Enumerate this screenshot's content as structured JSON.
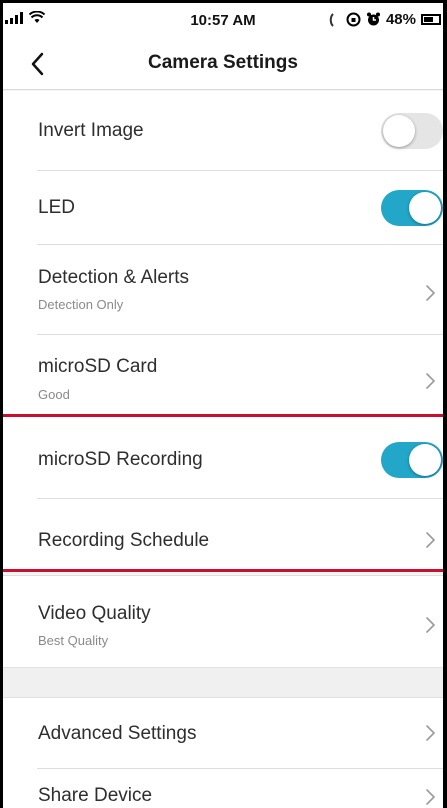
{
  "status_bar": {
    "time": "10:57 AM",
    "battery_text": "48%",
    "icons": [
      "signal-icon",
      "wifi-icon",
      "call-icon",
      "lock-rotation-icon",
      "alarm-icon",
      "battery-icon"
    ]
  },
  "nav": {
    "title": "Camera Settings",
    "back_icon": "chevron-left-icon"
  },
  "settings": {
    "invert_image": {
      "label": "Invert Image",
      "enabled": false
    },
    "led": {
      "label": "LED",
      "enabled": true
    },
    "detection_alerts": {
      "label": "Detection & Alerts",
      "value": "Detection Only"
    },
    "microsd_card": {
      "label": "microSD Card",
      "value": "Good"
    },
    "microsd_recording": {
      "label": "microSD Recording",
      "enabled": true
    },
    "recording_schedule": {
      "label": "Recording Schedule"
    },
    "video_quality": {
      "label": "Video Quality",
      "value": "Best Quality"
    },
    "advanced_settings": {
      "label": "Advanced Settings"
    },
    "share_device": {
      "label": "Share Device"
    }
  },
  "colors": {
    "toggle_on": "#22a7c9",
    "toggle_off": "#e5e5e5",
    "highlight_line": "#c8102e",
    "background": "#f4f4f4"
  }
}
